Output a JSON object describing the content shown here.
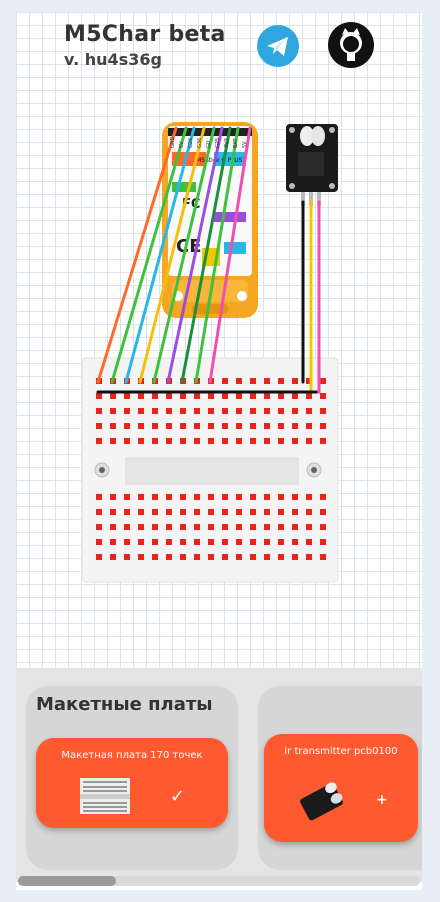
{
  "app": {
    "title": "M5Char beta",
    "version": "v. hu4s36g"
  },
  "icons": {
    "telegram": "telegram-icon",
    "github": "github-icon"
  },
  "modules": {
    "controller_label_top": "M5Stick C PLUS2",
    "controller_labels": [
      "GND",
      "5V",
      "G26",
      "G36",
      "G0",
      "G25",
      "3V3",
      "BAT",
      "5V"
    ],
    "ir_module": "ir transmitter"
  },
  "colors": {
    "wires": [
      "#ff6a2b",
      "#3ec23e",
      "#29b7e8",
      "#f2c10f",
      "#9b4de0",
      "#1b8f3a",
      "#f04fb0",
      "#111111",
      "#f0c800"
    ],
    "breadboard_hole": "#e8241c",
    "accent": "#ff5a2f"
  },
  "catalog": {
    "section_title": "Макетные платы",
    "cards": [
      {
        "label": "Макетная плата 170 точек",
        "action": "✓"
      },
      {
        "label": "ir transmitter pcb0100",
        "action": "+"
      }
    ]
  }
}
